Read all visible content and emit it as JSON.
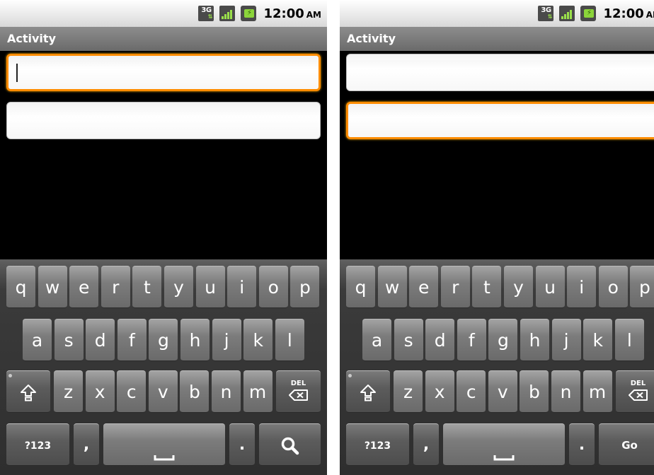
{
  "screens": [
    {
      "status": {
        "time": "12:00",
        "ampm": "AM",
        "network": "3G"
      },
      "title": "Activity",
      "fields": [
        {
          "value": "",
          "focused": true
        },
        {
          "value": "",
          "focused": false
        }
      ],
      "keyboard": {
        "row1": [
          "q",
          "w",
          "e",
          "r",
          "t",
          "y",
          "u",
          "i",
          "o",
          "p"
        ],
        "row2": [
          "a",
          "s",
          "d",
          "f",
          "g",
          "h",
          "j",
          "k",
          "l"
        ],
        "row3": [
          "z",
          "x",
          "c",
          "v",
          "b",
          "n",
          "m"
        ],
        "del_label": "DEL",
        "symbols_label": "?123",
        "comma_label": ",",
        "period_label": ".",
        "action": "search-icon"
      }
    },
    {
      "status": {
        "time": "12:00",
        "ampm": "AM",
        "network": "3G"
      },
      "title": "Activity",
      "fields": [
        {
          "value": "",
          "focused": false
        },
        {
          "value": "",
          "focused": true
        }
      ],
      "keyboard": {
        "row1": [
          "q",
          "w",
          "e",
          "r",
          "t",
          "y",
          "u",
          "i",
          "o",
          "p"
        ],
        "row2": [
          "a",
          "s",
          "d",
          "f",
          "g",
          "h",
          "j",
          "k",
          "l"
        ],
        "row3": [
          "z",
          "x",
          "c",
          "v",
          "b",
          "n",
          "m"
        ],
        "del_label": "DEL",
        "symbols_label": "?123",
        "comma_label": ",",
        "period_label": ".",
        "action_label": "Go"
      }
    }
  ],
  "colors": {
    "focus": "#ff8c00",
    "signal": "#9ae04a",
    "battery": "#8bd43a"
  }
}
